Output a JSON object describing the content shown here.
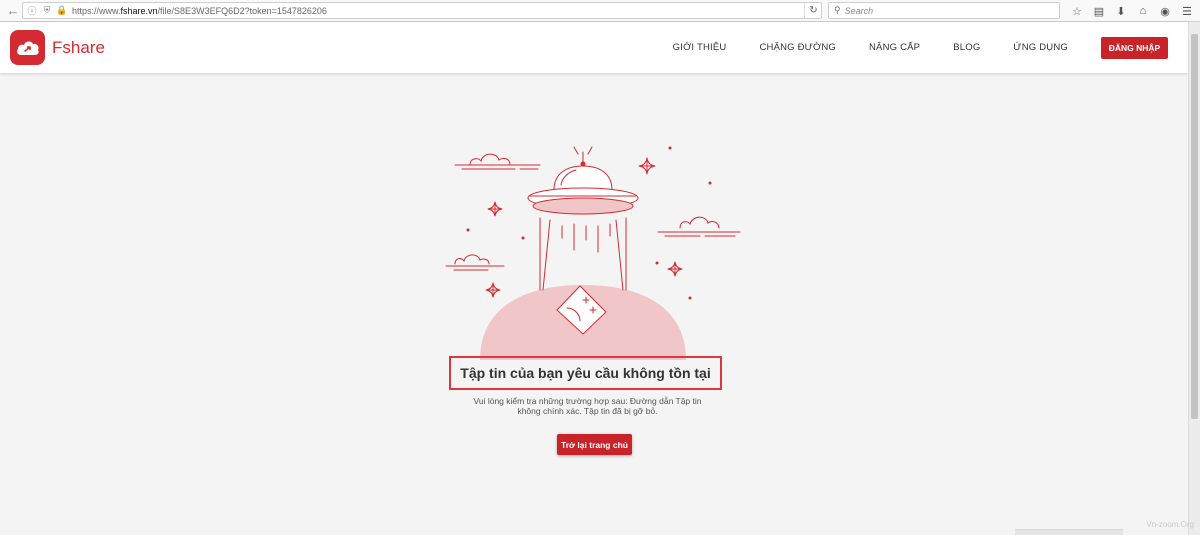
{
  "browser": {
    "url_prefix": "https://www.",
    "url_domain": "fshare.vn",
    "url_suffix": "/file/S8E3W3EFQ6D2?token=1547826206",
    "search_placeholder": "Search"
  },
  "header": {
    "logo_text": "Fshare",
    "nav": [
      "GIỚI THIỆU",
      "CHẶNG ĐƯỜNG",
      "NÂNG CẤP",
      "BLOG",
      "ỨNG DỤNG"
    ],
    "login_label": "ĐĂNG NHẬP"
  },
  "main": {
    "title": "Tập tin của bạn yêu cầu không tồn tại",
    "description": "Vui lòng kiểm tra những trường hợp sau: Đường dẫn Tập tin không chính xác. Tập tin đã bị gỡ bỏ.",
    "home_button": "Trở lại trang chủ"
  },
  "watermark": "Vn-zoom.Org",
  "colors": {
    "brand": "#c9232a",
    "illustration_line": "#d42a31",
    "planet_fill": "#f1c6c8",
    "background": "#f4f4f4"
  }
}
